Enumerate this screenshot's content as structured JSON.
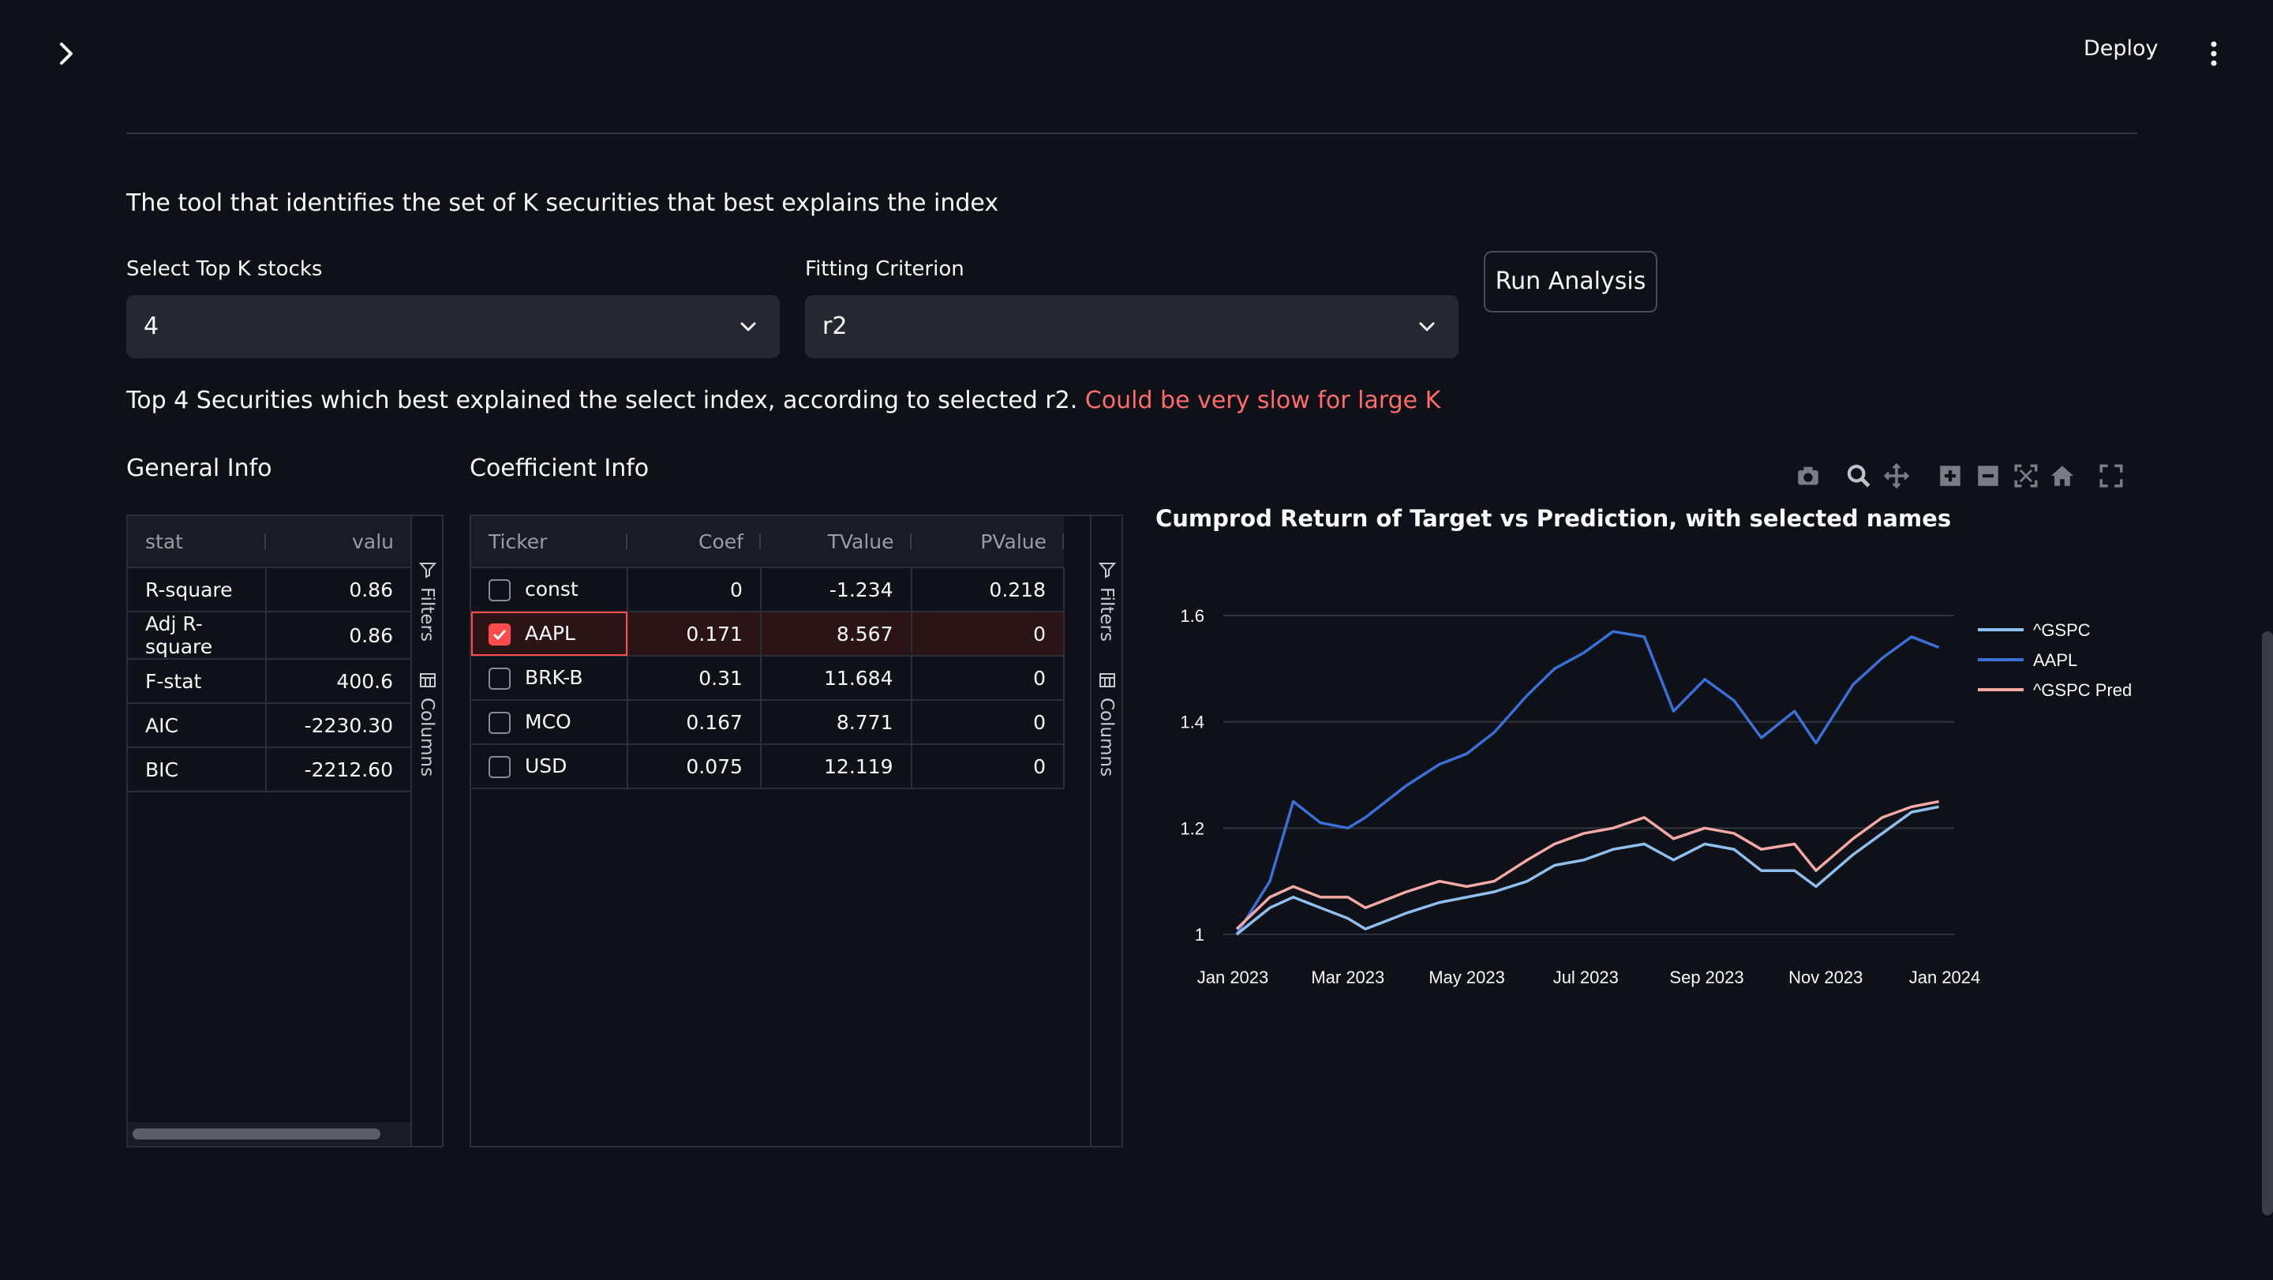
{
  "header": {
    "deploy_label": "Deploy"
  },
  "intro": "The tool that identifies the set of K securities that best explains the index",
  "controls": {
    "topk_label": "Select Top K stocks",
    "topk_value": "4",
    "criterion_label": "Fitting Criterion",
    "criterion_value": "r2",
    "run_label": "Run Analysis"
  },
  "summary": {
    "text": "Top 4 Securities which best explained the select index, according to selected r2.",
    "warning": "Could be very slow for large K"
  },
  "general_info": {
    "heading": "General Info",
    "columns": [
      "stat",
      "valu"
    ],
    "rows": [
      [
        "R-square",
        "0.86"
      ],
      [
        "Adj R-square",
        "0.86"
      ],
      [
        "F-stat",
        "400.6"
      ],
      [
        "AIC",
        "-2230.30"
      ],
      [
        "BIC",
        "-2212.60"
      ]
    ],
    "filters_label": "Filters",
    "columns_label": "Columns"
  },
  "coef_info": {
    "heading": "Coefficient Info",
    "columns": [
      "Ticker",
      "Coef",
      "TValue",
      "PValue"
    ],
    "rows": [
      {
        "ticker": "const",
        "coef": "0",
        "tvalue": "-1.234",
        "pvalue": "0.218",
        "checked": false
      },
      {
        "ticker": "AAPL",
        "coef": "0.171",
        "tvalue": "8.567",
        "pvalue": "0",
        "checked": true
      },
      {
        "ticker": "BRK-B",
        "coef": "0.31",
        "tvalue": "11.684",
        "pvalue": "0",
        "checked": false
      },
      {
        "ticker": "MCO",
        "coef": "0.167",
        "tvalue": "8.771",
        "pvalue": "0",
        "checked": false
      },
      {
        "ticker": "USD",
        "coef": "0.075",
        "tvalue": "12.119",
        "pvalue": "0",
        "checked": false
      }
    ],
    "filters_label": "Filters",
    "columns_label": "Columns"
  },
  "colors": {
    "gspc": "#8fbfef",
    "aapl": "#3a6fd8",
    "pred": "#f4a9a4",
    "accent": "#ff4b4b",
    "warning": "#ff6b6b"
  },
  "chart_data": {
    "type": "line",
    "title": "Cumprod Return of Target vs Prediction, with selected names",
    "xlabel": "",
    "ylabel": "",
    "x_ticks": [
      "Jan 2023",
      "Mar 2023",
      "May 2023",
      "Jul 2023",
      "Sep 2023",
      "Nov 2023",
      "Jan 2024"
    ],
    "y_ticks": [
      "1",
      "1.2",
      "1.4",
      "1.6"
    ],
    "ylim": [
      1.0,
      1.6
    ],
    "legend": "right",
    "x": [
      "2023-01-03",
      "2023-01-20",
      "2023-02-01",
      "2023-02-15",
      "2023-03-01",
      "2023-03-10",
      "2023-03-31",
      "2023-04-17",
      "2023-05-01",
      "2023-05-15",
      "2023-06-01",
      "2023-06-15",
      "2023-06-30",
      "2023-07-15",
      "2023-07-31",
      "2023-08-15",
      "2023-08-31",
      "2023-09-15",
      "2023-09-29",
      "2023-10-16",
      "2023-10-27",
      "2023-11-15",
      "2023-11-30",
      "2023-12-15",
      "2023-12-29"
    ],
    "series": [
      {
        "name": "^GSPC",
        "values": [
          1.0,
          1.05,
          1.07,
          1.05,
          1.03,
          1.01,
          1.04,
          1.06,
          1.07,
          1.08,
          1.1,
          1.13,
          1.14,
          1.16,
          1.17,
          1.14,
          1.17,
          1.16,
          1.12,
          1.12,
          1.09,
          1.15,
          1.19,
          1.23,
          1.24
        ]
      },
      {
        "name": "AAPL",
        "values": [
          1.0,
          1.1,
          1.25,
          1.21,
          1.2,
          1.22,
          1.28,
          1.32,
          1.34,
          1.38,
          1.45,
          1.5,
          1.53,
          1.57,
          1.56,
          1.42,
          1.48,
          1.44,
          1.37,
          1.42,
          1.36,
          1.47,
          1.52,
          1.56,
          1.54
        ]
      },
      {
        "name": "^GSPC Pred",
        "values": [
          1.01,
          1.07,
          1.09,
          1.07,
          1.07,
          1.05,
          1.08,
          1.1,
          1.09,
          1.1,
          1.14,
          1.17,
          1.19,
          1.2,
          1.22,
          1.18,
          1.2,
          1.19,
          1.16,
          1.17,
          1.12,
          1.18,
          1.22,
          1.24,
          1.25
        ]
      }
    ]
  }
}
